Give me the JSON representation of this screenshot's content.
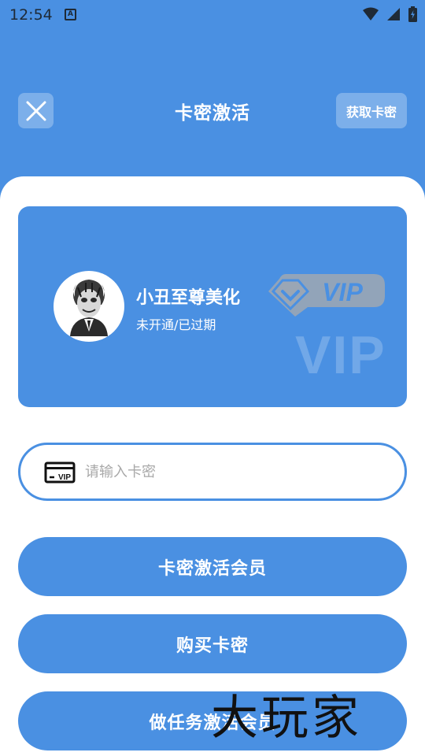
{
  "status_bar": {
    "time": "12:54",
    "notification_icon": "A"
  },
  "header": {
    "title": "卡密激活",
    "get_card_label": "获取卡密"
  },
  "vip_card": {
    "name": "小丑至尊美化",
    "status": "未开通/已过期",
    "badge_text": "VIP",
    "watermark_text": "VIP"
  },
  "card_input": {
    "placeholder": "请输入卡密",
    "value": "",
    "icon_label": "VIP"
  },
  "buttons": {
    "activate": "卡密激活会员",
    "buy": "购买卡密",
    "task_activate": "做任务激活会员"
  },
  "watermark": "大玩家",
  "colors": {
    "primary": "#4a90e2",
    "surface": "#ffffff",
    "placeholder": "#a8a8a8"
  }
}
